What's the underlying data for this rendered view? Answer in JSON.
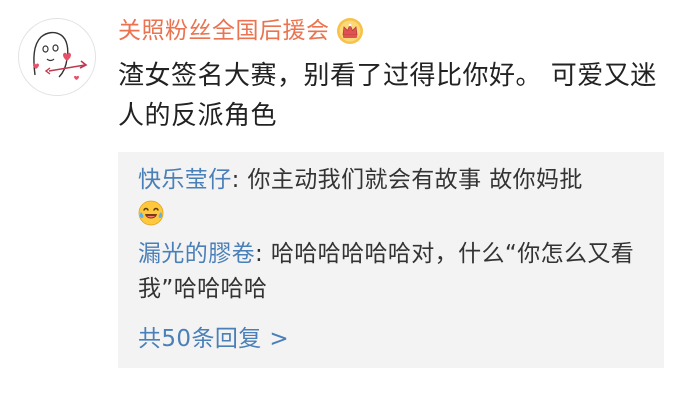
{
  "comment": {
    "username": "关照粉丝全国后援会",
    "badge_icon": "crown-badge-icon",
    "text": "渣女签名大赛，别看了过得比你好。 可爱又迷人的反派角色"
  },
  "replies": [
    {
      "user": "快乐莹仔",
      "separator": ": ",
      "text": "你主动我们就会有故事 故你妈批",
      "emoji": "laughing-tears-emoji-icon"
    },
    {
      "user": "漏光的膠卷",
      "separator": ": ",
      "text": "哈哈哈哈哈哈对，什么“你怎么又看我”哈哈哈哈"
    }
  ],
  "more_replies_label": "共50条回复 >",
  "colors": {
    "username": "#eb7350",
    "reply_user": "#4a7fb8",
    "body_text": "#222222",
    "reply_box_bg": "#f3f3f3"
  }
}
